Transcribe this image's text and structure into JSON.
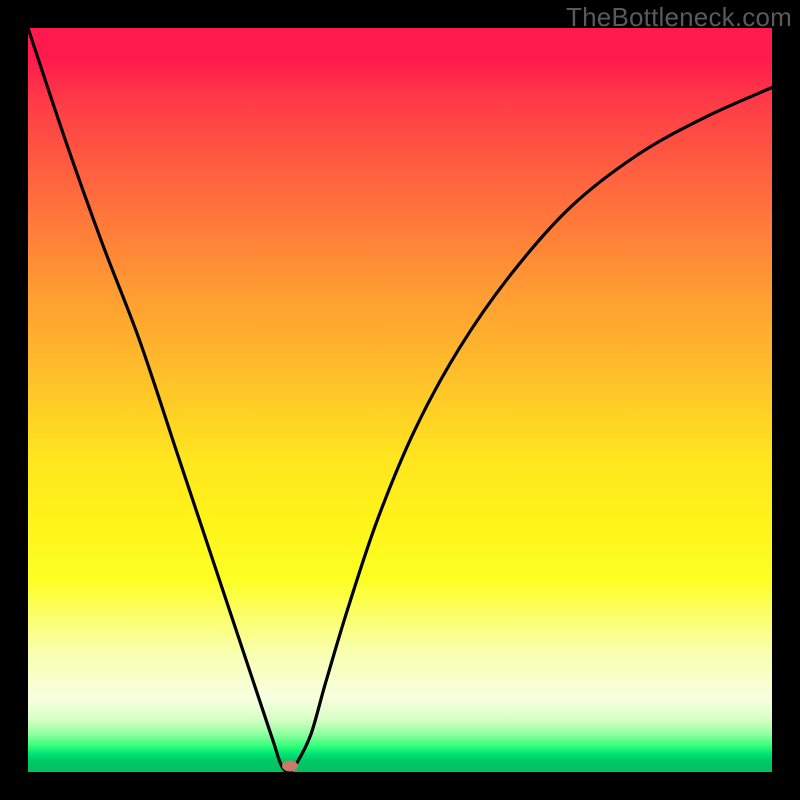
{
  "watermark": "TheBottleneck.com",
  "chart_data": {
    "type": "line",
    "title": "",
    "xlabel": "",
    "ylabel": "",
    "xlim": [
      0,
      100
    ],
    "ylim": [
      0,
      100
    ],
    "grid": false,
    "legend": false,
    "color_steps": [
      {
        "pos": 0,
        "color": "#ff1a4d"
      },
      {
        "pos": 50,
        "color": "#ffe61f"
      },
      {
        "pos": 90,
        "color": "#f7ffe0"
      },
      {
        "pos": 100,
        "color": "#00c060"
      }
    ],
    "series": [
      {
        "name": "bottleneck-curve",
        "x": [
          0,
          5,
          10,
          15,
          20,
          23,
          26,
          29,
          31,
          33,
          34,
          35,
          36,
          38,
          40,
          43,
          47,
          52,
          58,
          65,
          73,
          82,
          91,
          100
        ],
        "y": [
          100,
          85,
          71,
          58,
          43,
          34,
          25,
          16,
          10,
          4,
          1,
          0,
          1,
          5,
          12,
          22,
          34,
          46,
          57,
          67,
          76,
          83,
          88,
          92
        ]
      }
    ],
    "marker": {
      "x": 35.2,
      "y": 0.8,
      "color": "#c97a6a"
    }
  }
}
